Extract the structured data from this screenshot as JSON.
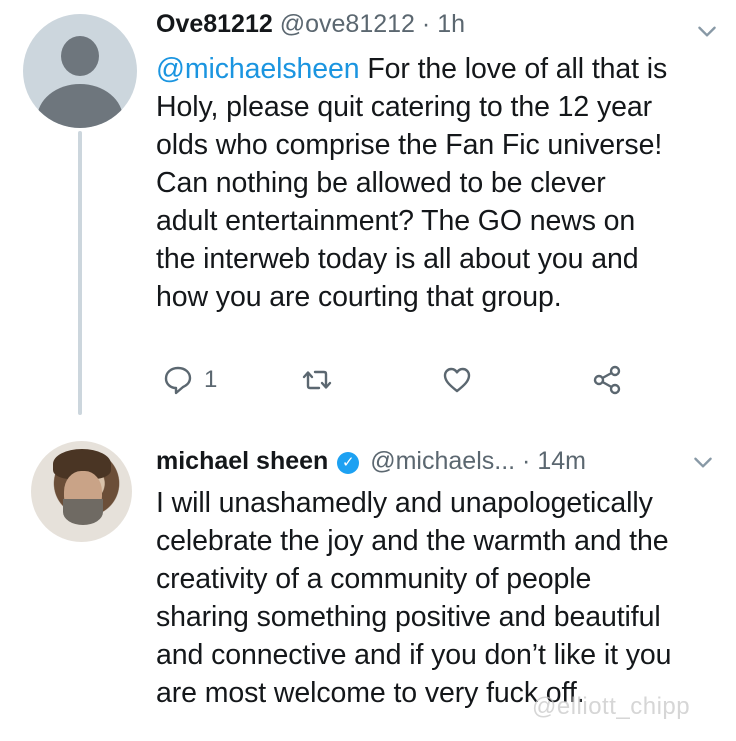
{
  "tweets": [
    {
      "avatar": "default-profile-icon",
      "name": "Ove81212",
      "handle": "@ove81212",
      "separator": "·",
      "time": "1h",
      "mention": "@michaelsheen",
      "lines": [
        " For the love of all that is",
        "Holy, please quit catering to the 12 year",
        "olds who comprise the Fan Fic universe!",
        "Can nothing be allowed to be clever",
        "adult entertainment?  The GO news on",
        "the interweb today is all about you and",
        "how you are courting that group."
      ],
      "actions": {
        "reply_count": "1",
        "icons": [
          "reply-icon",
          "retweet-icon",
          "like-icon",
          "share-icon"
        ]
      }
    },
    {
      "avatar": "profile-photo",
      "name": "michael sheen",
      "verified_icon": "✓",
      "handle": "@michaels...",
      "separator": "·",
      "time": "14m",
      "lines": [
        "I will unashamedly and unapologetically",
        "celebrate the joy and the warmth and the",
        "creativity of a community of people",
        "sharing something positive and beautiful",
        "and connective and if you don’t like it you",
        "are most welcome to very fuck off."
      ]
    }
  ],
  "watermark": "@elliott_chipp",
  "colors": {
    "link": "#1b95e0",
    "secondary_text": "#5b6770",
    "verified": "#1da1f2",
    "thread_line": "#ccd6dd"
  }
}
